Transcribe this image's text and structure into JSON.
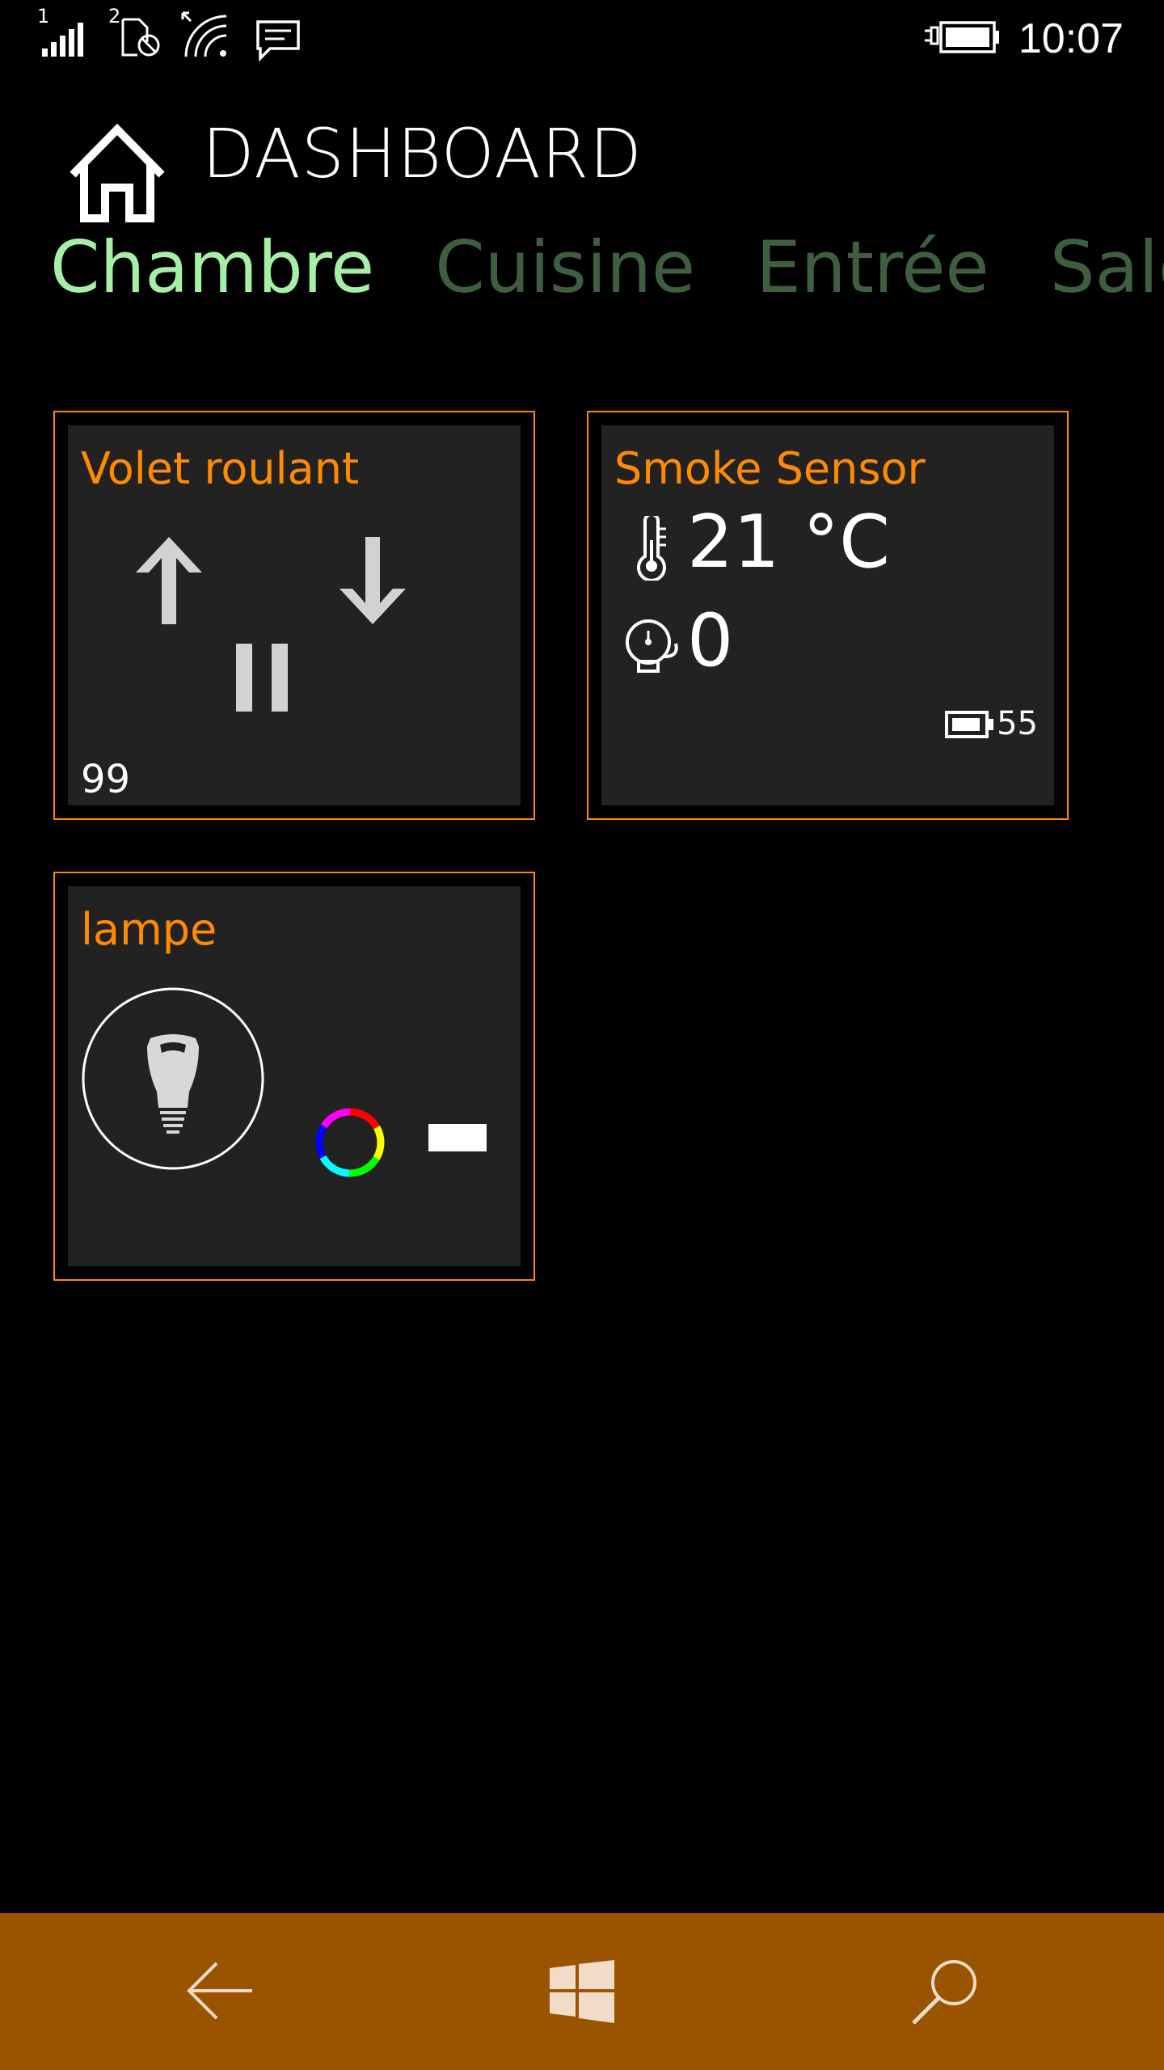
{
  "status_bar": {
    "sim1_label": "1",
    "sim2_label": "2",
    "time": "10:07"
  },
  "header": {
    "title": "DASHBOARD"
  },
  "pivot": {
    "tabs": [
      {
        "label": "Chambre",
        "active": true
      },
      {
        "label": "Cuisine",
        "active": false
      },
      {
        "label": "Entrée",
        "active": false
      },
      {
        "label": "Salon",
        "active": false
      }
    ]
  },
  "tiles": {
    "volet": {
      "title": "Volet roulant",
      "value": "99"
    },
    "smoke": {
      "title": "Smoke Sensor",
      "temperature": "21 °C",
      "alarm": "0",
      "battery": "55"
    },
    "lampe": {
      "title": "lampe"
    }
  },
  "colors": {
    "accent": "#ff8a00",
    "pivot_active": "#a6f0a6",
    "pivot_inactive": "#3f5e3f",
    "tile_bg": "#222222",
    "nav_bar": "#9a5400"
  },
  "icons": {
    "home": "home-icon",
    "up": "arrow-up-icon",
    "down": "arrow-down-icon",
    "pause": "pause-icon",
    "thermometer": "thermometer-icon",
    "alarm": "alarm-icon",
    "battery": "battery-icon",
    "bulb": "light-bulb-icon",
    "color": "color-wheel-icon",
    "back": "back-arrow-icon",
    "windows": "windows-logo-icon",
    "search": "search-icon"
  }
}
